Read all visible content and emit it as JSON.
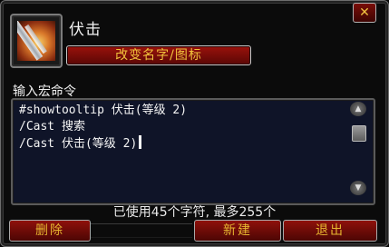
{
  "macro": {
    "name": "伏击",
    "icon": "ambush-dagger-icon",
    "rename_label": "改变名字/图标"
  },
  "editor": {
    "label": "输入宏命令",
    "lines": [
      "#showtooltip 伏击(等级 2)",
      "/Cast 搜索",
      "/Cast 伏击(等级 2)"
    ],
    "char_info": "已使用45个字符, 最多255个"
  },
  "buttons": {
    "delete": "删除",
    "new": "新建",
    "exit": "退出",
    "close": "✕"
  },
  "colors": {
    "button_red": "#8f110b",
    "button_text_gold": "#e6b530",
    "editor_bg": "#0f1428"
  }
}
